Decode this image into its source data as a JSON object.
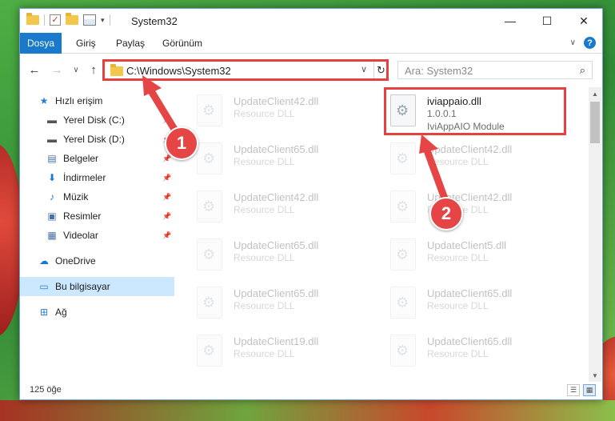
{
  "window": {
    "title": "System32"
  },
  "ribbon": {
    "tabs": [
      {
        "label": "Dosya",
        "active": true
      },
      {
        "label": "Giriş"
      },
      {
        "label": "Paylaş"
      },
      {
        "label": "Görünüm"
      }
    ],
    "help_label": "?"
  },
  "address": {
    "path": "C:\\Windows\\System32"
  },
  "search": {
    "placeholder": "Ara: System32"
  },
  "sidebar": {
    "items": [
      {
        "label": "Hızlı erişim",
        "icon": "star-icon"
      },
      {
        "label": "Yerel Disk (C:)",
        "icon": "drive-icon",
        "pinned": true
      },
      {
        "label": "Yerel Disk (D:)",
        "icon": "drive-icon",
        "pinned": true
      },
      {
        "label": "Belgeler",
        "icon": "documents-icon",
        "pinned": true
      },
      {
        "label": "İndirmeler",
        "icon": "download-icon",
        "pinned": true
      },
      {
        "label": "Müzik",
        "icon": "music-icon",
        "pinned": true
      },
      {
        "label": "Resimler",
        "icon": "pictures-icon",
        "pinned": true
      },
      {
        "label": "Videolar",
        "icon": "videos-icon",
        "pinned": true
      },
      {
        "label": "OneDrive",
        "icon": "cloud-icon"
      },
      {
        "label": "Bu bilgisayar",
        "icon": "computer-icon",
        "selected": true
      },
      {
        "label": "Ağ",
        "icon": "network-icon"
      }
    ]
  },
  "files": {
    "highlighted": {
      "name": "iviappaio.dll",
      "version": "1.0.0.1",
      "description": "IviAppAIO Module"
    },
    "faded": [
      {
        "name": "UpdateClient42.dll",
        "type": "Resource DLL"
      },
      {
        "name": "UpdateClient65.dll",
        "type": "Resource DLL"
      },
      {
        "name": "UpdateClient42.dll",
        "type": "Resource DLL"
      },
      {
        "name": "UpdateClient42.dll",
        "type": "Resource DLL"
      },
      {
        "name": "UpdateClient42.dll",
        "type": "Resource DLL"
      },
      {
        "name": "UpdateClient65.dll",
        "type": "Resource DLL"
      },
      {
        "name": "UpdateClient5.dll",
        "type": "Resource DLL"
      },
      {
        "name": "UpdateClient65.dll",
        "type": "Resource DLL"
      },
      {
        "name": "UpdateClient65.dll",
        "type": "Resource DLL"
      },
      {
        "name": "UpdateClient19.dll",
        "type": "Resource DLL"
      },
      {
        "name": "UpdateClient65.dll",
        "type": "Resource DLL"
      }
    ]
  },
  "status": {
    "item_count": "125 öğe"
  },
  "annotations": {
    "step1": "1",
    "step2": "2"
  },
  "colors": {
    "accent": "#1979ca",
    "highlight": "#e64040",
    "selection": "#cce8ff"
  }
}
